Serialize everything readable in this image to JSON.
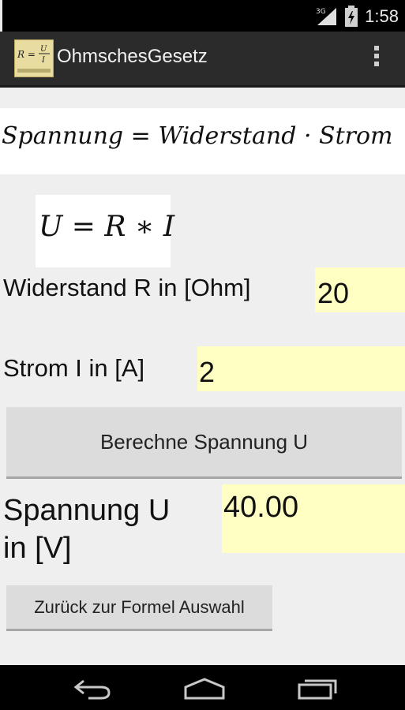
{
  "status_bar": {
    "network": "3G",
    "time": "1:58"
  },
  "action_bar": {
    "title": "OhmschesGesetz",
    "icon": "formula-app-icon",
    "menu_icon": "overflow-menu-icon"
  },
  "formula": {
    "verbal": "Spannung = Widerstand · Strom",
    "symbolic": "U = R ∗ I"
  },
  "inputs": {
    "resistance": {
      "label": "Widerstand R in [Ohm]",
      "value": "20"
    },
    "current": {
      "label": "Strom I in [A]",
      "value": "2"
    }
  },
  "calculate_button": {
    "label": "Berechne Spannung U"
  },
  "result": {
    "label_line1": "Spannung U",
    "label_line2": "in [V]",
    "value": "40.00"
  },
  "back_button": {
    "label": "Zurück zur Formel Auswahl"
  },
  "navigation": {
    "back_icon": "back-icon",
    "home_icon": "home-icon",
    "recents_icon": "recent-apps-icon"
  },
  "colors": {
    "field_background": "#ffffc4",
    "action_bar": "#2b2b2b",
    "content_background": "#efefef"
  }
}
